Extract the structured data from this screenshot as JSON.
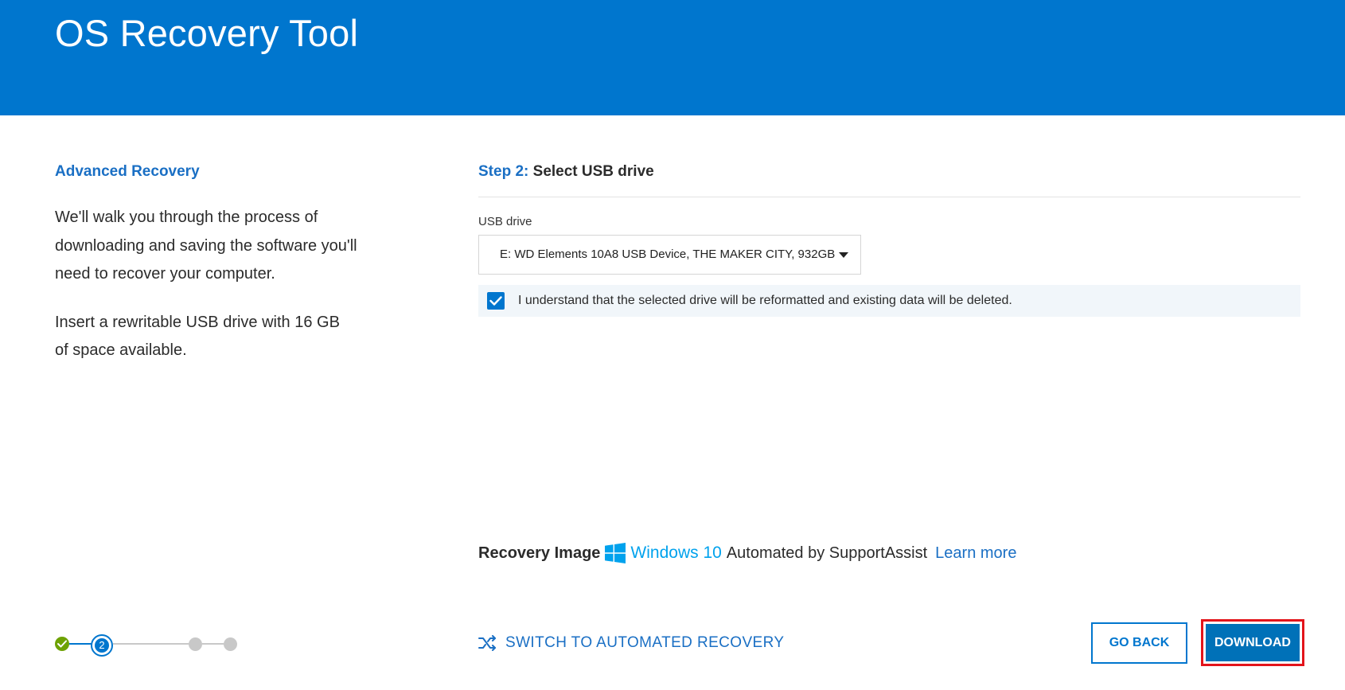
{
  "app": {
    "title": "OS Recovery Tool"
  },
  "left_panel": {
    "title": "Advanced Recovery",
    "description_1": "We'll walk you through the process of downloading and saving the software you'll need to recover your computer.",
    "description_2": "Insert a rewritable USB drive with 16 GB of space available."
  },
  "step": {
    "prefix": "Step 2:",
    "title": "Select USB drive"
  },
  "usb": {
    "label": "USB drive",
    "selected": "E: WD Elements 10A8 USB Device, THE MAKER CITY, 932GB"
  },
  "acknowledgement": {
    "checked": true,
    "text": "I understand that the selected drive will be reformatted and existing data will be deleted."
  },
  "recovery_image": {
    "label": "Recovery Image",
    "os": "Windows 10",
    "description": "Automated by SupportAssist",
    "learn_more": "Learn more"
  },
  "progress": {
    "current_step": "2"
  },
  "actions": {
    "switch_label": "SWITCH TO AUTOMATED RECOVERY",
    "back_label": "GO BACK",
    "download_label": "DOWNLOAD"
  },
  "colors": {
    "brand": "#0076ce",
    "link": "#1a6fc4",
    "success": "#6ea204",
    "highlight": "#e3141b",
    "windows": "#00a2ed"
  },
  "icons": {
    "checkbox": "checkmark-icon",
    "dropdown": "caret-down-icon",
    "os": "windows-logo-icon",
    "switch": "shuffle-icon",
    "step_done": "checkmark-icon"
  }
}
